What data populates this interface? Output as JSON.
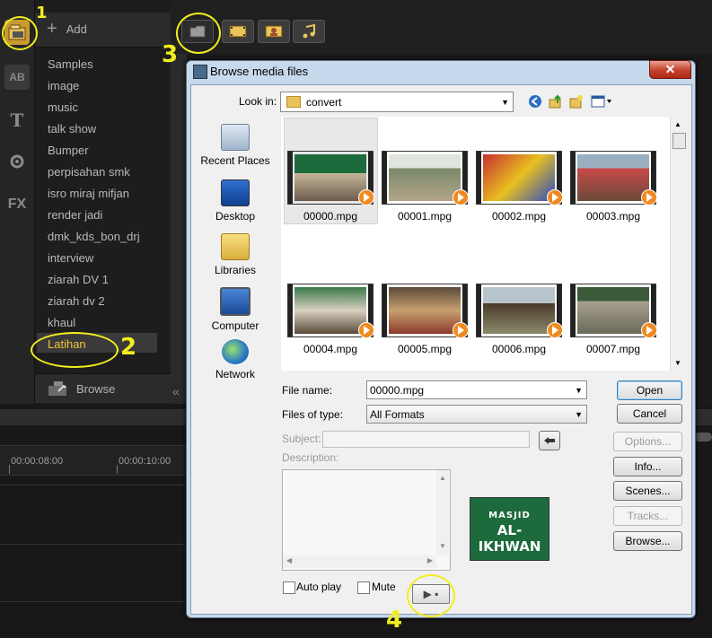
{
  "library": {
    "add_label": "Add",
    "items": [
      "Samples",
      "image",
      "music",
      "talk show",
      "Bumper",
      "perpisahan smk",
      "isro miraj mifjan",
      "render jadi",
      "dmk_kds_bon_drj",
      "interview",
      "ziarah DV 1",
      "ziarah dv 2",
      "khaul",
      "Latihan"
    ],
    "selected": "Latihan",
    "browse_label": "Browse"
  },
  "left_strip": {
    "icons": [
      "media-icon",
      "title-icon",
      "text-icon",
      "graphics-icon",
      "fx-icon"
    ],
    "title_glyph": "AB",
    "text_glyph": "T",
    "fx_glyph": "FX"
  },
  "media_tabs": [
    "folder-icon",
    "video-icon",
    "photo-icon",
    "audio-icon"
  ],
  "timeline": {
    "ruler": [
      "00:00:08:00",
      "00:00:10:00"
    ]
  },
  "annotations": [
    "1",
    "2",
    "3",
    "4"
  ],
  "dialog": {
    "title": "Browse media files",
    "close_glyph": "✕",
    "look_in_label": "Look in:",
    "look_in_value": "convert",
    "places": [
      "Recent Places",
      "Desktop",
      "Libraries",
      "Computer",
      "Network"
    ],
    "files": [
      "00000.mpg",
      "00001.mpg",
      "00002.mpg",
      "00003.mpg",
      "00004.mpg",
      "00005.mpg",
      "00006.mpg",
      "00007.mpg"
    ],
    "selected_file": "00000.mpg",
    "file_name_label": "File name:",
    "file_name_value": "00000.mpg",
    "files_of_type_label": "Files of type:",
    "files_of_type_value": "All Formats",
    "subject_label": "Subject:",
    "description_label": "Description:",
    "buttons": {
      "open": "Open",
      "cancel": "Cancel",
      "options": "Options...",
      "info": "Info...",
      "scenes": "Scenes...",
      "tracks": "Tracks...",
      "browse": "Browse..."
    },
    "auto_play_label": "Auto play",
    "mute_label": "Mute",
    "preview": {
      "line1": "MASJID",
      "line2": "AL-IKHWAN"
    },
    "play_glyph": "▶ ▪"
  }
}
